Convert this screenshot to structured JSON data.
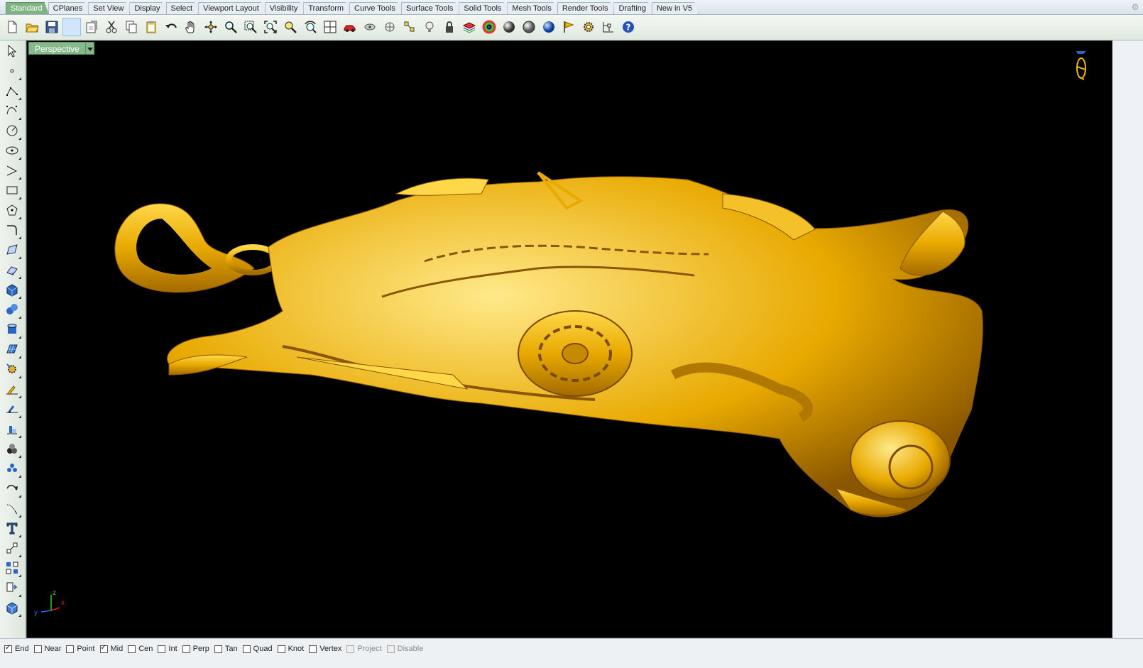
{
  "tabs": {
    "items": [
      {
        "label": "Standard",
        "active": true
      },
      {
        "label": "CPlanes"
      },
      {
        "label": "Set View"
      },
      {
        "label": "Display"
      },
      {
        "label": "Select"
      },
      {
        "label": "Viewport Layout"
      },
      {
        "label": "Visibility"
      },
      {
        "label": "Transform"
      },
      {
        "label": "Curve Tools"
      },
      {
        "label": "Surface Tools"
      },
      {
        "label": "Solid Tools"
      },
      {
        "label": "Mesh Tools"
      },
      {
        "label": "Render Tools"
      },
      {
        "label": "Drafting"
      },
      {
        "label": "New in V5"
      }
    ]
  },
  "toolbar": {
    "icons": [
      "new-icon",
      "open-icon",
      "save-icon",
      "print-icon",
      "import-icon",
      "cut-icon",
      "copy-icon",
      "paste-icon",
      "undo-icon",
      "pan-icon",
      "rotate-view-icon",
      "zoom-icon",
      "zoom-window-icon",
      "zoom-extents-icon",
      "zoom-selected-icon",
      "undo-view-icon",
      "four-viewports-icon",
      "car-object-icon",
      "hide-icon",
      "show-icon",
      "select-points-icon",
      "light-icon",
      "lock-icon",
      "layers-icon",
      "color-wheel-icon",
      "shaded-sphere-icon",
      "rendered-sphere-icon",
      "render-blue-sphere-icon",
      "flag-icon",
      "settings-gear-icon",
      "dimension-icon",
      "help-icon"
    ]
  },
  "left_tools": {
    "icons": [
      "select-arrow-icon",
      "point-icon",
      "polyline-icon",
      "curve-icon",
      "circle-icon",
      "ellipse-icon",
      "arc-icon",
      "rectangle-icon",
      "polygon-icon",
      "fillet-curve-icon",
      "surface-corner-icon",
      "extrude-icon",
      "box-icon",
      "sphere-icon",
      "cylinder-icon",
      "planar-surface-icon",
      "transform-gear-icon",
      "move-icon",
      "edit-points-icon",
      "boolean-icon",
      "array-icon",
      "offset-curve-icon",
      "distance-icon",
      "text-icon",
      "dimension-icon",
      "group-icon",
      "explode-icon",
      "block-icon"
    ],
    "more_label": "»"
  },
  "viewport": {
    "label": "Perspective",
    "axis_x": "x",
    "axis_y": "y",
    "axis_z": "z",
    "background": "#000000",
    "model_color": "#f2b800"
  },
  "osnap": {
    "items": [
      {
        "label": "End",
        "checked": true
      },
      {
        "label": "Near",
        "checked": false
      },
      {
        "label": "Point",
        "checked": false
      },
      {
        "label": "Mid",
        "checked": true
      },
      {
        "label": "Cen",
        "checked": false
      },
      {
        "label": "Int",
        "checked": false
      },
      {
        "label": "Perp",
        "checked": false
      },
      {
        "label": "Tan",
        "checked": false
      },
      {
        "label": "Quad",
        "checked": false
      },
      {
        "label": "Knot",
        "checked": false
      },
      {
        "label": "Vertex",
        "checked": false
      },
      {
        "label": "Project",
        "checked": false,
        "disabled": true
      },
      {
        "label": "Disable",
        "checked": false,
        "disabled": true
      }
    ]
  }
}
